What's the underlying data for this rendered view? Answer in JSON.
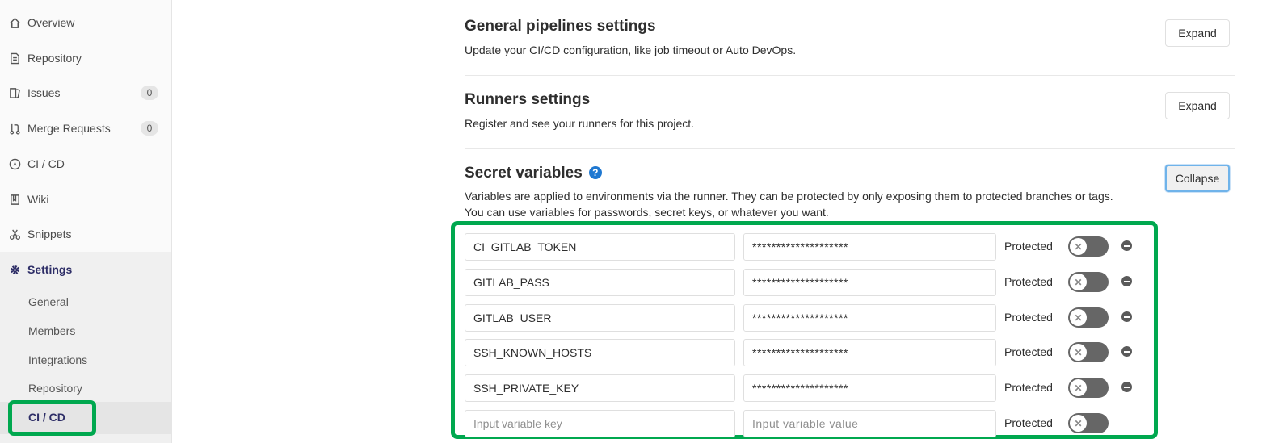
{
  "sidebar": {
    "items": [
      {
        "label": "Overview",
        "icon": "home-icon"
      },
      {
        "label": "Repository",
        "icon": "document-icon"
      },
      {
        "label": "Issues",
        "icon": "issues-icon",
        "count": "0"
      },
      {
        "label": "Merge Requests",
        "icon": "merge-request-icon",
        "count": "0"
      },
      {
        "label": "CI / CD",
        "icon": "rocket-icon"
      },
      {
        "label": "Wiki",
        "icon": "book-icon"
      },
      {
        "label": "Snippets",
        "icon": "scissors-icon"
      },
      {
        "label": "Settings",
        "icon": "gear-icon"
      }
    ],
    "settings_sub": [
      "General",
      "Members",
      "Integrations",
      "Repository",
      "CI / CD"
    ]
  },
  "sections": {
    "pipelines": {
      "title": "General pipelines settings",
      "desc": "Update your CI/CD configuration, like job timeout or Auto DevOps.",
      "button": "Expand"
    },
    "runners": {
      "title": "Runners settings",
      "desc": "Register and see your runners for this project.",
      "button": "Expand"
    },
    "secrets": {
      "title": "Secret variables",
      "help": "?",
      "desc_line1": "Variables are applied to environments via the runner. They can be protected by only exposing them to protected branches or tags.",
      "desc_line2": "You can use variables for passwords, secret keys, or whatever you want.",
      "button": "Collapse"
    }
  },
  "variables": [
    {
      "key": "CI_GITLAB_TOKEN",
      "value": "********************",
      "protected_label": "Protected"
    },
    {
      "key": "GITLAB_PASS",
      "value": "********************",
      "protected_label": "Protected"
    },
    {
      "key": "GITLAB_USER",
      "value": "********************",
      "protected_label": "Protected"
    },
    {
      "key": "SSH_KNOWN_HOSTS",
      "value": "********************",
      "protected_label": "Protected"
    },
    {
      "key": "SSH_PRIVATE_KEY",
      "value": "********************",
      "protected_label": "Protected"
    }
  ],
  "new_variable": {
    "key_placeholder": "Input variable key",
    "value_placeholder": "Input variable value",
    "protected_label": "Protected"
  },
  "toggle_off_glyph": "✕",
  "colors": {
    "highlight": "#00a84f",
    "help": "#1f78d1",
    "toggle": "#666666"
  }
}
